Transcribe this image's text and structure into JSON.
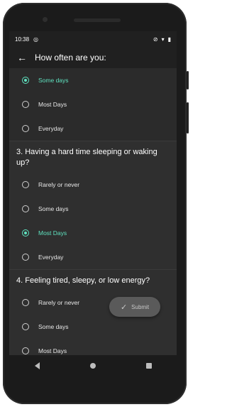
{
  "status": {
    "time": "10:38"
  },
  "header": {
    "title": "How often are you:"
  },
  "q2": {
    "options": [
      "Some days",
      "Most Days",
      "Everyday"
    ],
    "selected": 0
  },
  "q3": {
    "title": "3. Having a hard time sleeping or waking up?",
    "options": [
      "Rarely or never",
      "Some days",
      "Most Days",
      "Everyday"
    ],
    "selected": 2
  },
  "q4": {
    "title": "4. Feeling tired, sleepy, or low energy?",
    "options": [
      "Rarely or never",
      "Some days",
      "Most Days"
    ]
  },
  "submit": {
    "label": "Submit"
  },
  "colors": {
    "accent": "#5fe3c0",
    "background": "#2f2f2f",
    "appbar": "#202020"
  }
}
